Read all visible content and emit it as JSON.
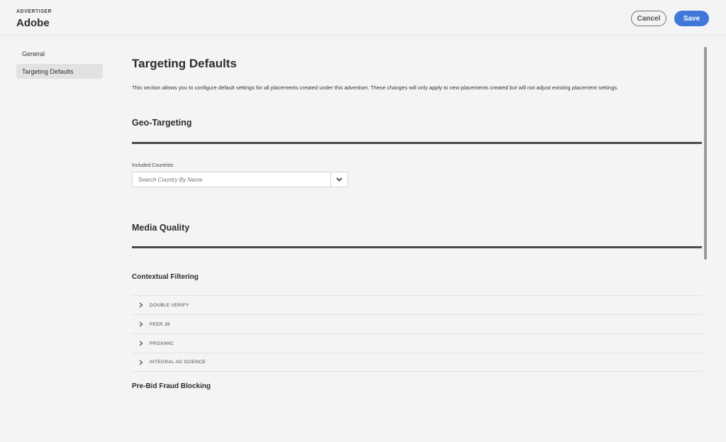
{
  "header": {
    "eyebrow": "ADVERTISER",
    "title": "Adobe",
    "cancel_label": "Cancel",
    "save_label": "Save"
  },
  "sidebar": {
    "items": [
      {
        "label": "General",
        "active": false
      },
      {
        "label": "Targeting Defaults",
        "active": true
      }
    ]
  },
  "main": {
    "title": "Targeting Defaults",
    "description": "This section allows you to configure default settings for all placements created under this advertiser. These changes will only apply to new placements created but will not adjust existing placement settings.",
    "geo": {
      "title": "Geo-Targeting",
      "field_label": "Included Countries",
      "placeholder": "Search Country By Name"
    },
    "media": {
      "title": "Media Quality",
      "contextual_title": "Contextual Filtering",
      "providers": [
        "DOUBLE VERIFY",
        "PEER 39",
        "PROXIMIC",
        "INTEGRAL AD SCIENCE"
      ],
      "prebid_title": "Pre-Bid Fraud Blocking"
    }
  },
  "colors": {
    "accent": "#3f78d8",
    "background": "#f4f4f4",
    "rule": "#4b4b4b"
  },
  "icons": {
    "dropdown": "chevron-down-icon",
    "accordion": "chevron-right-icon"
  }
}
